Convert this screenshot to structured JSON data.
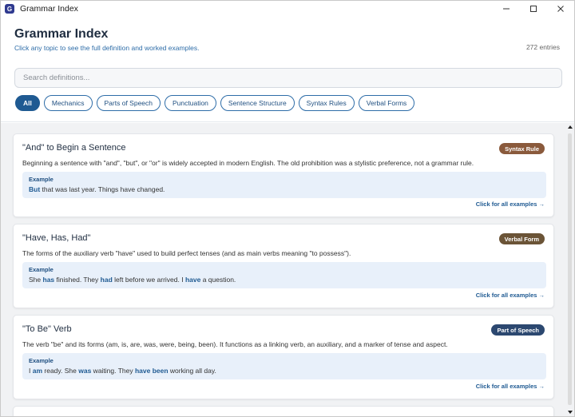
{
  "window": {
    "title": "Grammar Index",
    "icon_letter": "G"
  },
  "header": {
    "title": "Grammar Index",
    "subtitle": "Click any topic to see the full definition and worked examples.",
    "count": "272 entries"
  },
  "search": {
    "placeholder": "Search definitions...",
    "value": ""
  },
  "filters": [
    {
      "label": "All",
      "active": true
    },
    {
      "label": "Mechanics",
      "active": false
    },
    {
      "label": "Parts of Speech",
      "active": false
    },
    {
      "label": "Punctuation",
      "active": false
    },
    {
      "label": "Sentence Structure",
      "active": false
    },
    {
      "label": "Syntax Rules",
      "active": false
    },
    {
      "label": "Verbal Forms",
      "active": false
    }
  ],
  "cards": [
    {
      "title": "\"And\" to Begin a Sentence",
      "badge": "Syntax Rule",
      "badge_color": "#8a5a3c",
      "description": "Beginning a sentence with \"and\", \"but\", or \"or\" is widely accepted in modern English. The old prohibition was a stylistic preference, not a grammar rule.",
      "example_label": "Example",
      "example_segments": [
        {
          "text": "But",
          "strong": true
        },
        {
          "text": " that was last year. Things have changed.",
          "strong": false
        }
      ],
      "link": "Click for all examples →"
    },
    {
      "title": "\"Have, Has, Had\"",
      "badge": "Verbal Form",
      "badge_color": "#6b5437",
      "description": "The forms of the auxiliary verb \"have\" used to build perfect tenses (and as main verbs meaning \"to possess\").",
      "example_label": "Example",
      "example_segments": [
        {
          "text": "She ",
          "strong": false
        },
        {
          "text": "has",
          "strong": true
        },
        {
          "text": " finished. They ",
          "strong": false
        },
        {
          "text": "had",
          "strong": true
        },
        {
          "text": " left before we arrived. I ",
          "strong": false
        },
        {
          "text": "have",
          "strong": true
        },
        {
          "text": " a question.",
          "strong": false
        }
      ],
      "link": "Click for all examples →"
    },
    {
      "title": "\"To Be\" Verb",
      "badge": "Part of Speech",
      "badge_color": "#2c4870",
      "description": "The verb \"be\" and its forms (am, is, are, was, were, being, been). It functions as a linking verb, an auxiliary, and a marker of tense and aspect.",
      "example_label": "Example",
      "example_segments": [
        {
          "text": "I ",
          "strong": false
        },
        {
          "text": "am",
          "strong": true
        },
        {
          "text": " ready. She ",
          "strong": false
        },
        {
          "text": "was",
          "strong": true
        },
        {
          "text": " waiting. They ",
          "strong": false
        },
        {
          "text": "have been",
          "strong": true
        },
        {
          "text": " working all day.",
          "strong": false
        }
      ],
      "link": "Click for all examples →"
    }
  ],
  "icons": {
    "minimize": "minimize-icon",
    "maximize": "maximize-icon",
    "close": "close-icon",
    "scroll_up": "scroll-up-arrow-icon",
    "scroll_down": "scroll-down-arrow-icon"
  }
}
